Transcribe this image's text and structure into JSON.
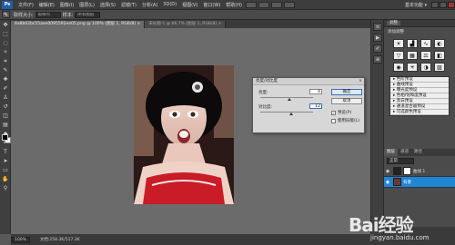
{
  "menubar": {
    "items": [
      "文件(F)",
      "编辑(E)",
      "图像(I)",
      "图层(L)",
      "选择(S)",
      "滤镜(T)",
      "分析(A)",
      "3D(D)",
      "视图(V)",
      "窗口(W)",
      "帮助(H)"
    ],
    "workspace": "基本功能 ▾"
  },
  "options": {
    "sample_label": "取样大小:",
    "sample_value": "取样点",
    "sample2_label": "样本:",
    "sample2_value": "所有图层"
  },
  "tabs": [
    {
      "label": "8a8b02bc55aee0095592ee05.png @ 100% (图层 1, RGB/8) ×",
      "active": true
    },
    {
      "label": "未标题-1 @ 66.7% (图层 1, RGB/8) ×",
      "active": false
    }
  ],
  "dialog": {
    "title": "亮度/对比度",
    "brightness_label": "亮度:",
    "brightness_value": "4",
    "contrast_label": "对比度:",
    "contrast_value": "12",
    "ok": "确定",
    "cancel": "取消",
    "preview_label": "预览(P)",
    "legacy_label": "使用旧版(L)"
  },
  "adjustments": {
    "tab_label": "调整",
    "subtitle": "添加调整",
    "presets": [
      "色阶预设",
      "曲线预设",
      "曝光度预设",
      "色相/饱和度预设",
      "黑白预设",
      "通道混合器预设",
      "可选颜色预设"
    ]
  },
  "layers": {
    "tabs": [
      "图层",
      "通道",
      "路径"
    ],
    "blend_mode": "正常",
    "rows": [
      {
        "name": "曲线 1",
        "selected": false
      },
      {
        "name": "背景",
        "selected": true
      }
    ]
  },
  "status": {
    "zoom": "100%",
    "doc": "文档:258.3K/517.3K"
  },
  "watermark": {
    "brand": "Bai经验",
    "url": "jingyan.baidu.com"
  },
  "colors": {
    "selection_blue": "#1f86d6",
    "ui_dark": "#3d3d3d",
    "workspace_gray": "#6b6b6b"
  }
}
